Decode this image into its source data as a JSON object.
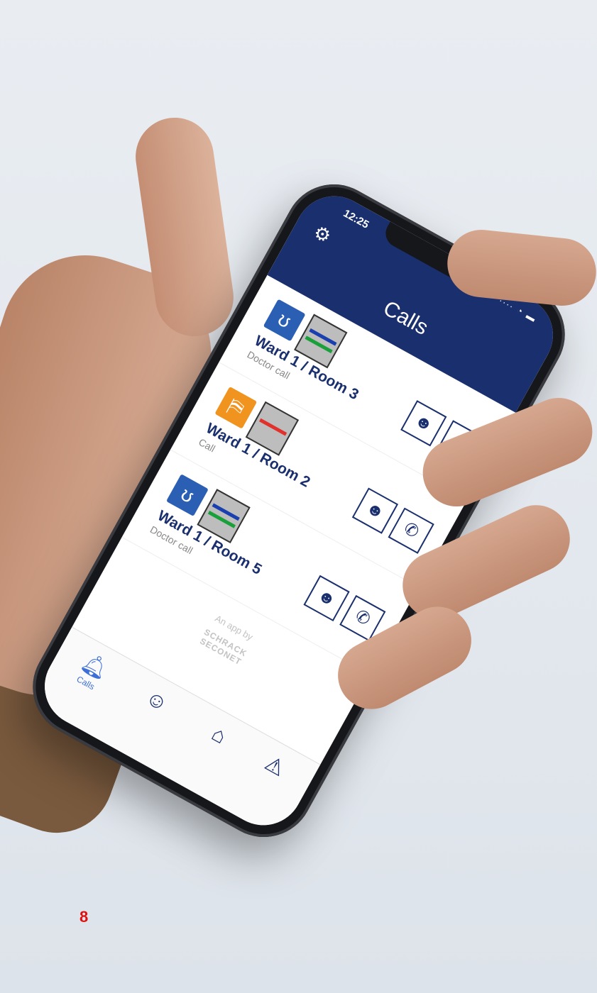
{
  "status": {
    "time": "12:25",
    "indicators": "∙∙∙∙ ◔ ▬"
  },
  "header": {
    "title": "Calls",
    "settings_icon": "gear-icon"
  },
  "calls": [
    {
      "room": "Ward 1 / Room 3",
      "type": "Doctor call",
      "icon": "stethoscope-icon",
      "icon_color": "#2b5fb4",
      "status_bars": [
        "#1a3fae",
        "#1aa03a"
      ]
    },
    {
      "room": "Ward 1 / Room 2",
      "type": "Call",
      "icon": "door-icon",
      "icon_color": "#f0931f",
      "status_bars": [
        "#e0312c"
      ]
    },
    {
      "room": "Ward 1 / Room 5",
      "type": "Doctor call",
      "icon": "stethoscope-icon",
      "icon_color": "#2b5fb4",
      "status_bars": [
        "#1a3fae",
        "#1aa03a"
      ]
    }
  ],
  "credit": {
    "line1": "An app by",
    "line2": "SCHRACK",
    "line3": "SECONET"
  },
  "tabs": [
    {
      "label": "Calls",
      "icon": "bell-icon"
    },
    {
      "label": "",
      "icon": "person-check-icon"
    },
    {
      "label": "",
      "icon": "room-icon"
    },
    {
      "label": "",
      "icon": "warning-icon"
    }
  ],
  "page_number": "8",
  "colors": {
    "primary": "#1a2f6e",
    "accent": "#3d6fd6",
    "page_number": "#e01010"
  }
}
